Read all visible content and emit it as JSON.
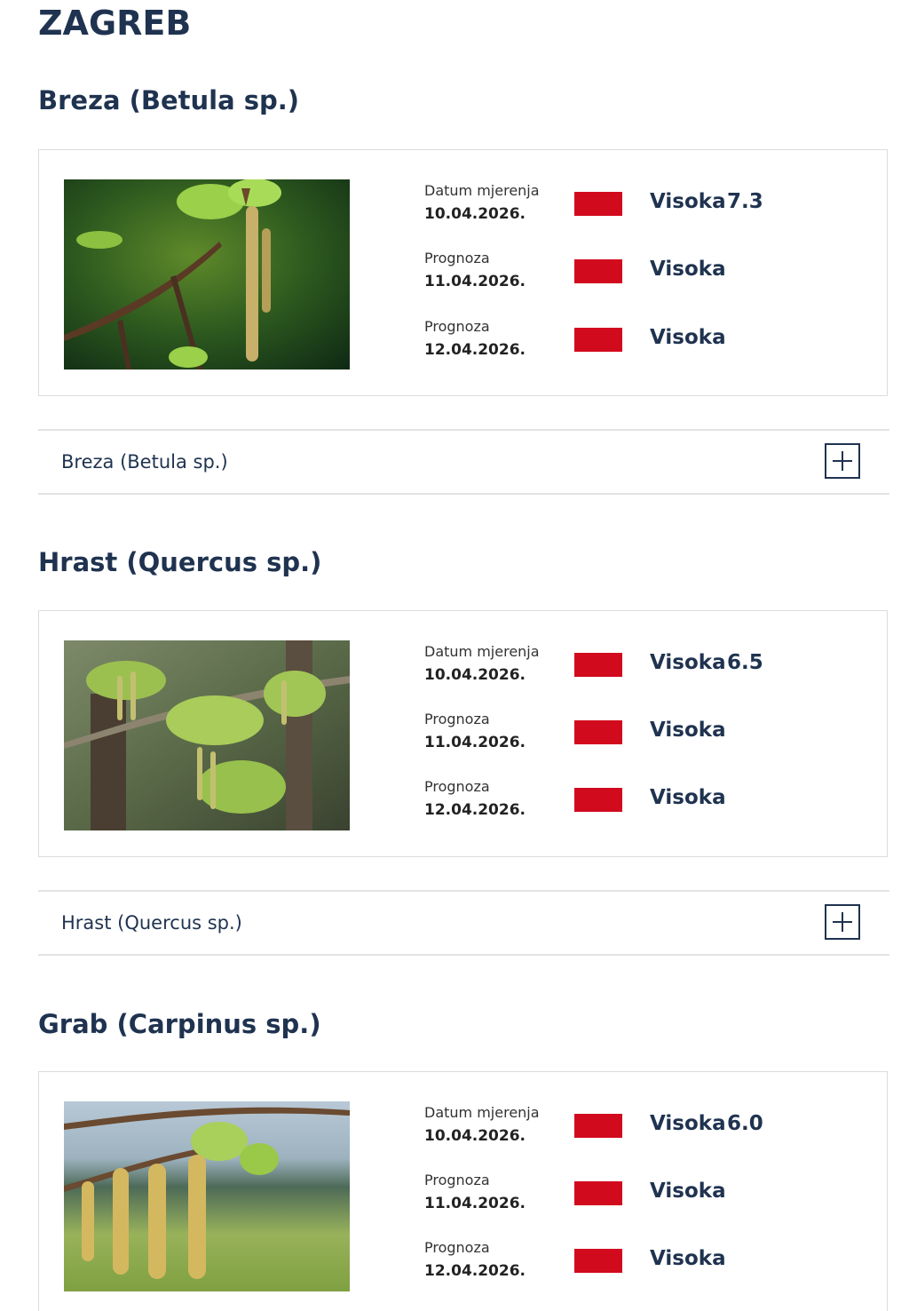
{
  "city": "ZAGREB",
  "level_color": "#d20a1e",
  "species": [
    {
      "title": "Breza (Betula sp.)",
      "image": "birch-catkins-photo",
      "rows": [
        {
          "label": "Datum mjerenja",
          "date": "10.04.2026.",
          "level": "Visoka",
          "value": "7.3"
        },
        {
          "label": "Prognoza",
          "date": "11.04.2026.",
          "level": "Visoka",
          "value": ""
        },
        {
          "label": "Prognoza",
          "date": "12.04.2026.",
          "level": "Visoka",
          "value": ""
        }
      ],
      "accordion_label": "Breza (Betula sp.)"
    },
    {
      "title": "Hrast (Quercus sp.)",
      "image": "oak-catkins-photo",
      "rows": [
        {
          "label": "Datum mjerenja",
          "date": "10.04.2026.",
          "level": "Visoka",
          "value": "6.5"
        },
        {
          "label": "Prognoza",
          "date": "11.04.2026.",
          "level": "Visoka",
          "value": ""
        },
        {
          "label": "Prognoza",
          "date": "12.04.2026.",
          "level": "Visoka",
          "value": ""
        }
      ],
      "accordion_label": "Hrast (Quercus sp.)"
    },
    {
      "title": "Grab (Carpinus sp.)",
      "image": "hornbeam-catkins-photo",
      "rows": [
        {
          "label": "Datum mjerenja",
          "date": "10.04.2026.",
          "level": "Visoka",
          "value": "6.0"
        },
        {
          "label": "Prognoza",
          "date": "11.04.2026.",
          "level": "Visoka",
          "value": ""
        },
        {
          "label": "Prognoza",
          "date": "12.04.2026.",
          "level": "Visoka",
          "value": ""
        }
      ]
    }
  ]
}
